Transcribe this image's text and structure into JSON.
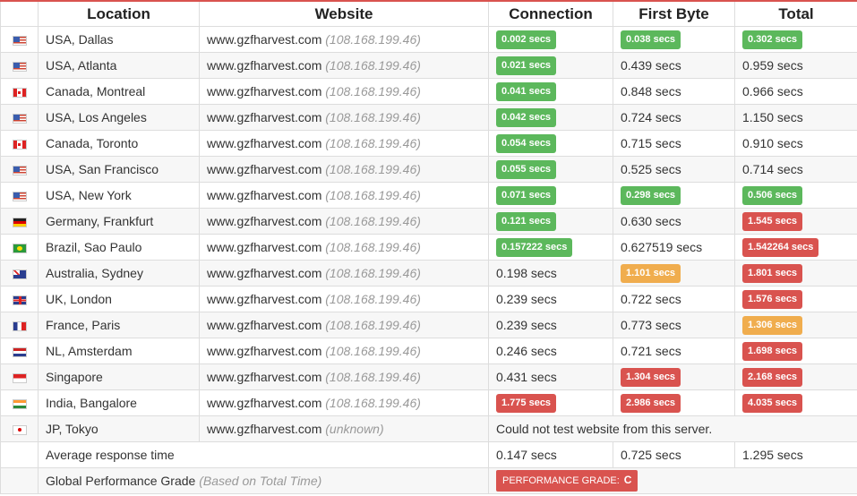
{
  "headers": {
    "location": "Location",
    "website": "Website",
    "connection": "Connection",
    "first_byte": "First Byte",
    "total": "Total"
  },
  "rows": [
    {
      "flag": "us",
      "location": "USA, Dallas",
      "site": "www.gzfharvest.com",
      "ip": "(108.168.199.46)",
      "connection": "0.002 secs",
      "connection_status": "g",
      "first_byte": "0.038 secs",
      "first_byte_status": "g",
      "total": "0.302 secs",
      "total_status": "g"
    },
    {
      "flag": "us",
      "location": "USA, Atlanta",
      "site": "www.gzfharvest.com",
      "ip": "(108.168.199.46)",
      "connection": "0.021 secs",
      "connection_status": "g",
      "first_byte": "0.439 secs",
      "first_byte_status": "",
      "total": "0.959 secs",
      "total_status": ""
    },
    {
      "flag": "ca",
      "location": "Canada, Montreal",
      "site": "www.gzfharvest.com",
      "ip": "(108.168.199.46)",
      "connection": "0.041 secs",
      "connection_status": "g",
      "first_byte": "0.848 secs",
      "first_byte_status": "",
      "total": "0.966 secs",
      "total_status": ""
    },
    {
      "flag": "us",
      "location": "USA, Los Angeles",
      "site": "www.gzfharvest.com",
      "ip": "(108.168.199.46)",
      "connection": "0.042 secs",
      "connection_status": "g",
      "first_byte": "0.724 secs",
      "first_byte_status": "",
      "total": "1.150 secs",
      "total_status": ""
    },
    {
      "flag": "ca",
      "location": "Canada, Toronto",
      "site": "www.gzfharvest.com",
      "ip": "(108.168.199.46)",
      "connection": "0.054 secs",
      "connection_status": "g",
      "first_byte": "0.715 secs",
      "first_byte_status": "",
      "total": "0.910 secs",
      "total_status": ""
    },
    {
      "flag": "us",
      "location": "USA, San Francisco",
      "site": "www.gzfharvest.com",
      "ip": "(108.168.199.46)",
      "connection": "0.055 secs",
      "connection_status": "g",
      "first_byte": "0.525 secs",
      "first_byte_status": "",
      "total": "0.714 secs",
      "total_status": ""
    },
    {
      "flag": "us",
      "location": "USA, New York",
      "site": "www.gzfharvest.com",
      "ip": "(108.168.199.46)",
      "connection": "0.071 secs",
      "connection_status": "g",
      "first_byte": "0.298 secs",
      "first_byte_status": "g",
      "total": "0.506 secs",
      "total_status": "g"
    },
    {
      "flag": "de",
      "location": "Germany, Frankfurt",
      "site": "www.gzfharvest.com",
      "ip": "(108.168.199.46)",
      "connection": "0.121 secs",
      "connection_status": "g",
      "first_byte": "0.630 secs",
      "first_byte_status": "",
      "total": "1.545 secs",
      "total_status": "r"
    },
    {
      "flag": "br",
      "location": "Brazil, Sao Paulo",
      "site": "www.gzfharvest.com",
      "ip": "(108.168.199.46)",
      "connection": "0.157222 secs",
      "connection_status": "g",
      "first_byte": "0.627519 secs",
      "first_byte_status": "",
      "total": "1.542264 secs",
      "total_status": "r"
    },
    {
      "flag": "au",
      "location": "Australia, Sydney",
      "site": "www.gzfharvest.com",
      "ip": "(108.168.199.46)",
      "connection": "0.198 secs",
      "connection_status": "",
      "first_byte": "1.101 secs",
      "first_byte_status": "o",
      "total": "1.801 secs",
      "total_status": "r"
    },
    {
      "flag": "uk",
      "location": "UK, London",
      "site": "www.gzfharvest.com",
      "ip": "(108.168.199.46)",
      "connection": "0.239 secs",
      "connection_status": "",
      "first_byte": "0.722 secs",
      "first_byte_status": "",
      "total": "1.576 secs",
      "total_status": "r"
    },
    {
      "flag": "fr",
      "location": "France, Paris",
      "site": "www.gzfharvest.com",
      "ip": "(108.168.199.46)",
      "connection": "0.239 secs",
      "connection_status": "",
      "first_byte": "0.773 secs",
      "first_byte_status": "",
      "total": "1.306 secs",
      "total_status": "o"
    },
    {
      "flag": "nl",
      "location": "NL, Amsterdam",
      "site": "www.gzfharvest.com",
      "ip": "(108.168.199.46)",
      "connection": "0.246 secs",
      "connection_status": "",
      "first_byte": "0.721 secs",
      "first_byte_status": "",
      "total": "1.698 secs",
      "total_status": "r"
    },
    {
      "flag": "sg",
      "location": "Singapore",
      "site": "www.gzfharvest.com",
      "ip": "(108.168.199.46)",
      "connection": "0.431 secs",
      "connection_status": "",
      "first_byte": "1.304 secs",
      "first_byte_status": "r",
      "total": "2.168 secs",
      "total_status": "r"
    },
    {
      "flag": "in",
      "location": "India, Bangalore",
      "site": "www.gzfharvest.com",
      "ip": "(108.168.199.46)",
      "connection": "1.775 secs",
      "connection_status": "r",
      "first_byte": "2.986 secs",
      "first_byte_status": "r",
      "total": "4.035 secs",
      "total_status": "r"
    },
    {
      "flag": "jp",
      "location": "JP, Tokyo",
      "site": "www.gzfharvest.com",
      "ip": "(unknown)",
      "error": "Could not test website from this server."
    }
  ],
  "average": {
    "label": "Average response time",
    "connection": "0.147 secs",
    "first_byte": "0.725 secs",
    "total": "1.295 secs"
  },
  "grade": {
    "label": "Global Performance Grade",
    "note": "(Based on Total Time)",
    "badge_label": "PERFORMANCE GRADE:",
    "value": "C"
  },
  "colors": {
    "good": "#5cb85c",
    "warn": "#f0ad4e",
    "bad": "#d9534f"
  }
}
